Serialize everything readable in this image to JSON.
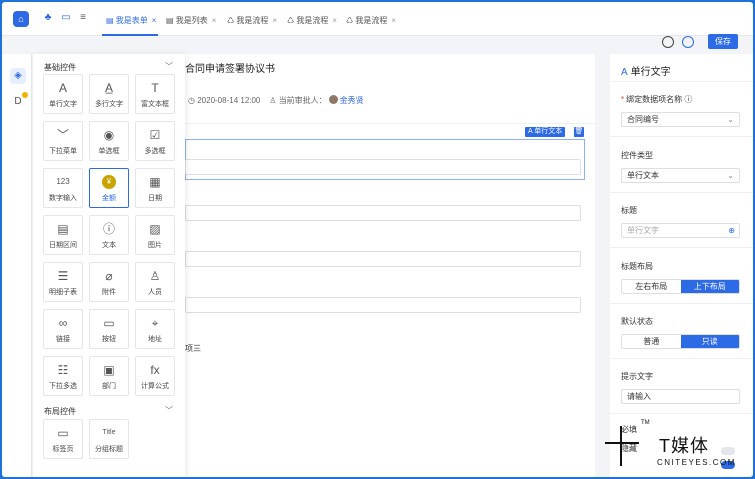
{
  "topbar": {
    "tabs": [
      {
        "label": "我是表单",
        "active": true
      },
      {
        "label": "我是列表",
        "active": false
      },
      {
        "label": "我是流程",
        "active": false
      },
      {
        "label": "我是流程",
        "active": false
      },
      {
        "label": "我是流程",
        "active": false
      }
    ],
    "close_glyph": "×"
  },
  "header": {
    "save_label": "保存"
  },
  "palette": {
    "basic_title": "基础控件",
    "layout_title": "布局控件",
    "basic": [
      {
        "label": "单行文字",
        "icon": "A"
      },
      {
        "label": "多行文字",
        "icon": "A̲"
      },
      {
        "label": "富文本框",
        "icon": "T"
      },
      {
        "label": "下拉菜单",
        "icon": "﹀"
      },
      {
        "label": "单选框",
        "icon": "◉"
      },
      {
        "label": "多选框",
        "icon": "☑"
      },
      {
        "label": "数字输入",
        "icon": "123"
      },
      {
        "label": "金额",
        "icon": "¥"
      },
      {
        "label": "日期",
        "icon": "▦"
      },
      {
        "label": "日期区间",
        "icon": "▤"
      },
      {
        "label": "文本",
        "icon": "ⓘ"
      },
      {
        "label": "图片",
        "icon": "▨"
      },
      {
        "label": "明细子表",
        "icon": "☰"
      },
      {
        "label": "附件",
        "icon": "⌀"
      },
      {
        "label": "人员",
        "icon": "♙"
      },
      {
        "label": "链接",
        "icon": "∞"
      },
      {
        "label": "按钮",
        "icon": "▭"
      },
      {
        "label": "地址",
        "icon": "⌖"
      },
      {
        "label": "下拉多选",
        "icon": "☷"
      },
      {
        "label": "部门",
        "icon": "▣"
      },
      {
        "label": "计算公式",
        "icon": "fx"
      }
    ],
    "layout": [
      {
        "label": "标签页",
        "icon": "▭"
      },
      {
        "label": "分组标题",
        "icon": "Title"
      }
    ]
  },
  "canvas": {
    "title": "合同申请签署协议书",
    "date_text": "2020-08-14 12:00",
    "approver_label": "当前审批人：",
    "approver_name": "金秀贤",
    "field_tag": "单行文本",
    "option_text": "项三"
  },
  "right_panel": {
    "title": "单行文字",
    "bind_label": "绑定数据项名称",
    "bind_value": "合同编号",
    "type_label": "控件类型",
    "type_value": "单行文本",
    "caption_label": "标题",
    "caption_placeholder": "单行文字",
    "layout_label": "标题布局",
    "layout_options": [
      "左右布局",
      "上下布局"
    ],
    "default_label": "默认状态",
    "default_options": [
      "普通",
      "只读"
    ],
    "hint_label": "提示文字",
    "hint_value": "请输入",
    "cut_label_1": "必填",
    "cut_label_2": "隐藏"
  },
  "watermark": {
    "text": "T媒体",
    "sub": "CNITEYES.COM",
    "tm": "TM"
  },
  "colors": {
    "accent": "#2c6ae6",
    "frame": "#1e73d8"
  }
}
